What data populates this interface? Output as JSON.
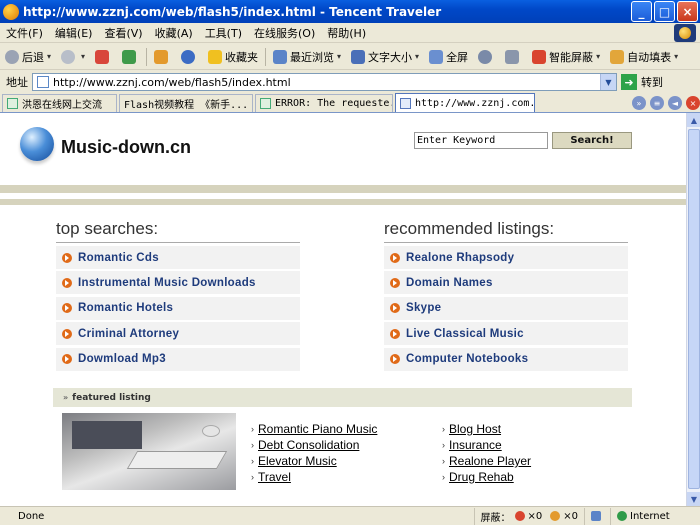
{
  "window": {
    "title": "http://www.zznj.com/web/flash5/index.html - Tencent Traveler",
    "minimize": "_",
    "maximize": "□",
    "close": "×"
  },
  "menu": [
    "文件(F)",
    "编辑(E)",
    "查看(V)",
    "收藏(A)",
    "工具(T)",
    "在线服务(O)",
    "帮助(H)"
  ],
  "toolbar": {
    "back": "后退",
    "favorites": "收藏夹",
    "recent": "最近浏览",
    "text_size": "文字大小",
    "fullscreen": "全屏",
    "smart_block": "智能屏蔽",
    "autofill": "自动填表"
  },
  "address": {
    "label": "地址",
    "url": "http://www.zznj.com/web/flash5/index.html",
    "go": "转到"
  },
  "tabs": [
    {
      "label": "洪恩在线网上交流"
    },
    {
      "label": "Flash视频教程 《新手..."
    },
    {
      "label": "ERROR: The requeste..."
    },
    {
      "label": "http://www.zznj.com..."
    }
  ],
  "site": {
    "name": "Music-down.cn",
    "search_value": "Enter Keyword",
    "search_button": "Search!"
  },
  "top_searches": {
    "title": "top searches:",
    "items": [
      "Romantic Cds",
      "Instrumental Music Downloads",
      "Romantic Hotels",
      "Criminal Attorney",
      "Dowmload Mp3"
    ]
  },
  "recommended": {
    "title": "recommended listings:",
    "items": [
      "Realone Rhapsody",
      "Domain Names",
      "Skype",
      "Live Classical Music",
      "Computer Notebooks"
    ]
  },
  "featured": {
    "title": "featured listing",
    "col1": [
      "Romantic Piano Music",
      "Debt Consolidation",
      "Elevator Music",
      "Travel"
    ],
    "col2": [
      "Blog Host",
      "Insurance",
      "Realone Player",
      "Drug Rehab"
    ]
  },
  "status": {
    "text": "Done",
    "block_label": "屏蔽：",
    "count1": "×0",
    "count2": "×0",
    "zone": "Internet"
  }
}
